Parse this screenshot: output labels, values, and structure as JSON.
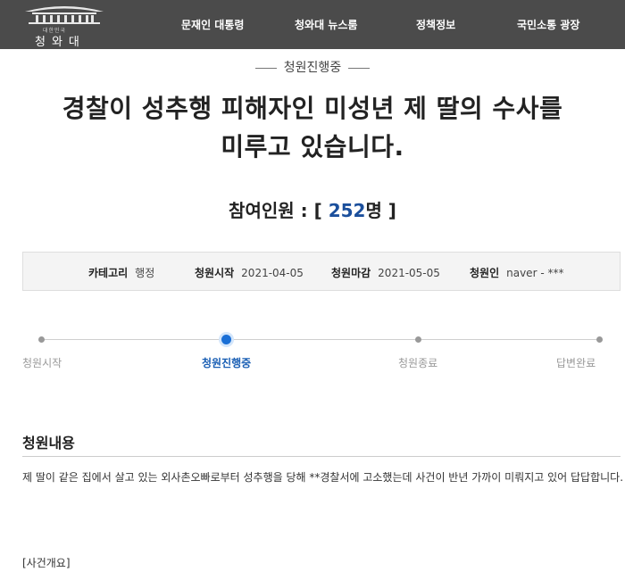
{
  "header": {
    "logo_sub": "대한민국",
    "logo_name": "청와대",
    "nav": [
      "문재인 대통령",
      "청와대 뉴스룸",
      "정책정보",
      "국민소통 광장"
    ]
  },
  "petition": {
    "status": "청원진행중",
    "title_line1": "경찰이 성추행 피해자인 미성년 제 딸의 수사를",
    "title_line2": "미루고 있습니다.",
    "participants_label": "참여인원 : [",
    "participants_count": "252",
    "participants_suffix": "명 ]",
    "meta": {
      "category_key": "카테고리",
      "category_val": "행정",
      "start_key": "청원시작",
      "start_val": "2021-04-05",
      "end_key": "청원마감",
      "end_val": "2021-05-05",
      "author_key": "청원인",
      "author_val": "naver - ***"
    },
    "progress": {
      "steps": [
        "청원시작",
        "청원진행중",
        "청원종료",
        "답변완료"
      ],
      "active_index": 1
    },
    "content": {
      "heading": "청원내용",
      "paragraph": "제 딸이 같은 집에서 살고 있는 외사촌오빠로부터 성추행을 당해 **경찰서에 고소했는데 사건이 반년 가까이 미뤄지고 있어 답답합니다.",
      "section_label": "[사건개요]"
    }
  }
}
